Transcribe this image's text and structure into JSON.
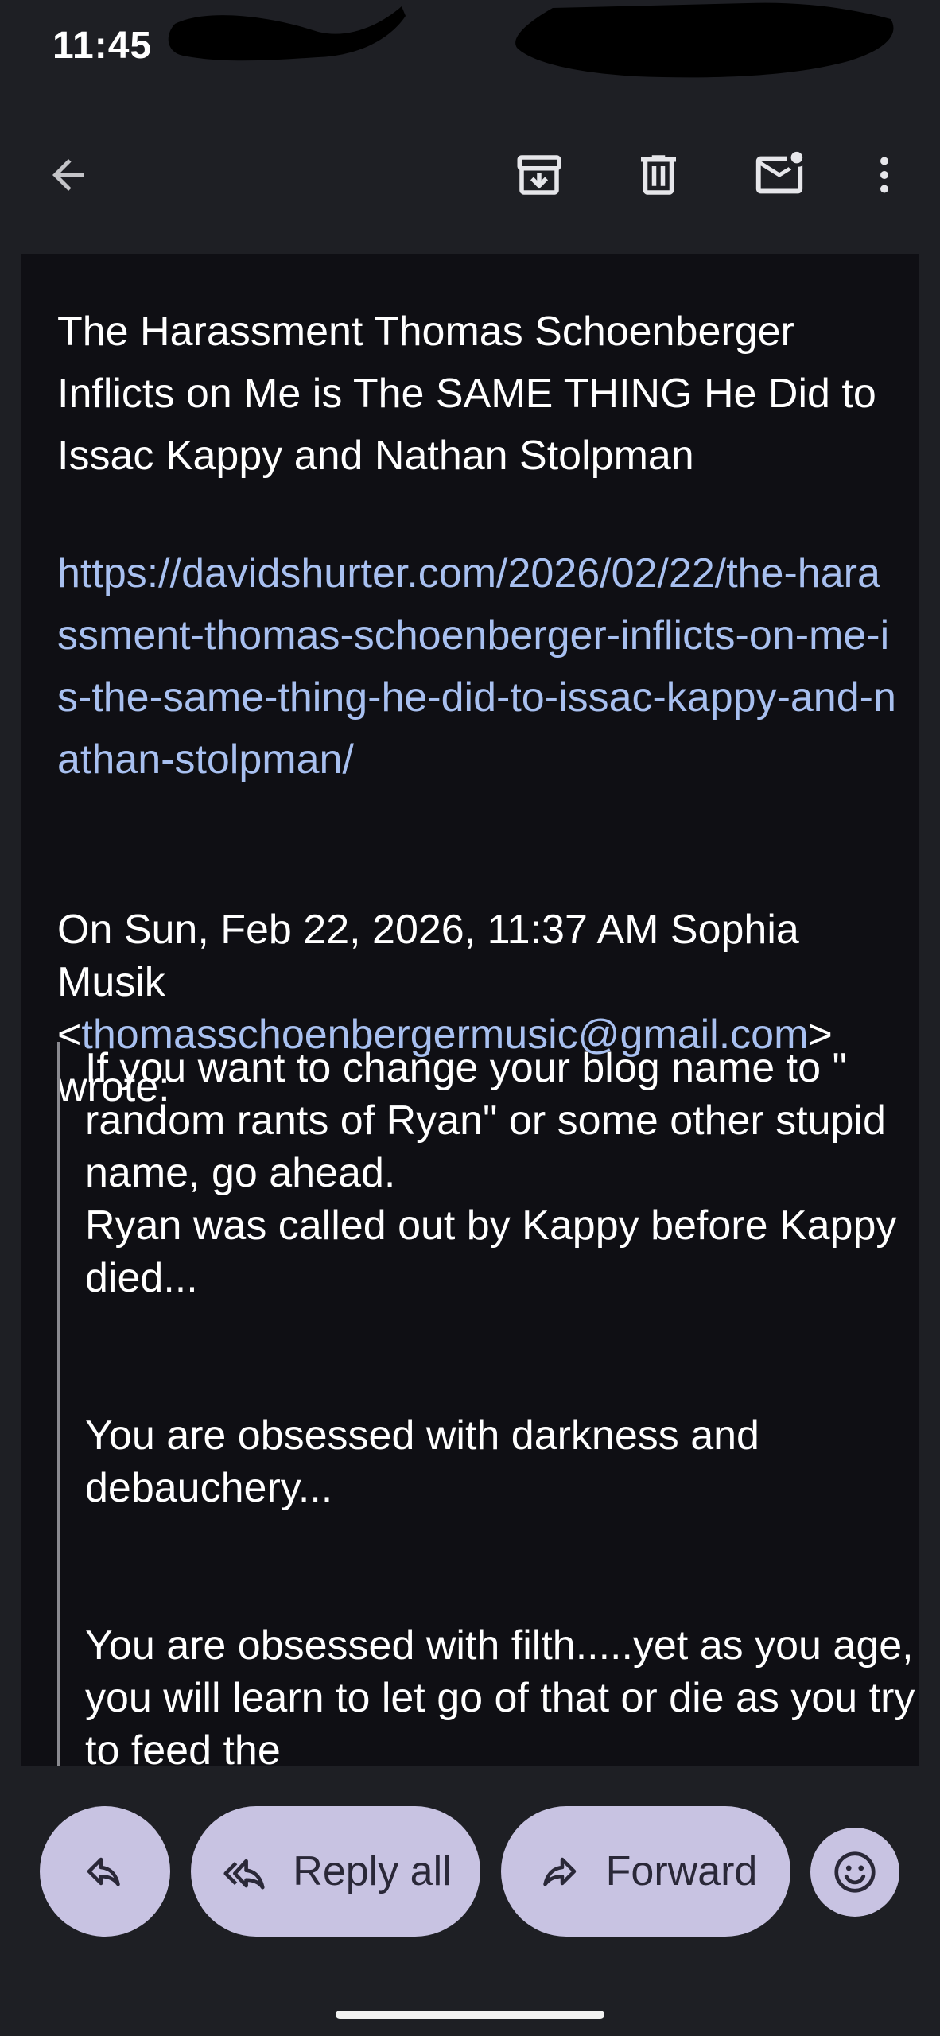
{
  "status_bar": {
    "time": "11:45"
  },
  "toolbar": {
    "back_icon": "arrow-left-icon",
    "archive_icon": "archive-icon",
    "delete_icon": "trash-icon",
    "mark_unread_icon": "mail-unread-icon",
    "more_icon": "more-vert-icon"
  },
  "message": {
    "subject": "The Harassment Thomas Schoenberger Inflicts on Me is The SAME THING He Did to Issac Kappy and Nathan Stolpman",
    "link": "https://davidshurter.com/2026/02/22/the-harassment-thomas-schoenberger-inflicts-on-me-is-the-same-thing-he-did-to-issac-kappy-and-nathan-stolpman/",
    "quote_header": {
      "prefix": "On Sun, Feb 22, 2026, 11:37 AM Sophia Musik <",
      "email": "thomasschoenbergermusic@gmail.com",
      "suffix": "> wrote:"
    },
    "quoted": {
      "p1_line1": "If you want to change your blog name to \" random rants of Ryan\" or some other stupid name, go ahead.",
      "p1_line2": "Ryan was called out by Kappy before Kappy died...",
      "p2": "You are obsessed with darkness and debauchery...",
      "p3": "You are obsessed with filth.....yet as you age, you will learn to let go of that or die as you try to feed the"
    }
  },
  "actions": {
    "reply_icon": "reply-icon",
    "reply_all_label": "Reply all",
    "reply_all_icon": "reply-all-icon",
    "forward_label": "Forward",
    "forward_icon": "forward-icon",
    "emoji_icon": "emoji-smile-icon"
  },
  "colors": {
    "background": "#1e1f24",
    "card": "#0f0f14",
    "link": "#a8c0f0",
    "pill": "#c8c3e2"
  }
}
